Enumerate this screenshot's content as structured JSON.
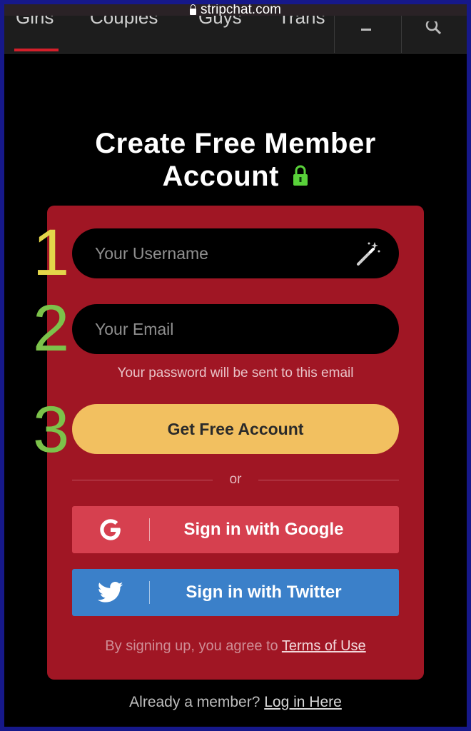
{
  "browser": {
    "url": "stripchat.com"
  },
  "nav": {
    "tabs": [
      {
        "label": "Girls"
      },
      {
        "label": "Couples"
      },
      {
        "label": "Guys"
      },
      {
        "label": "Trans"
      }
    ],
    "icons": [
      "menu-icon",
      "search-icon"
    ]
  },
  "title": {
    "line1": "Create Free Member",
    "line2": "Account"
  },
  "steps": [
    "1",
    "2",
    "3"
  ],
  "form": {
    "username_placeholder": "Your Username",
    "email_placeholder": "Your Email",
    "hint": "Your password will be sent to this email",
    "submit_label": "Get Free Account",
    "or_label": "or",
    "google_label": "Sign in with Google",
    "twitter_label": "Sign in with Twitter",
    "terms_prefix": "By signing up, you agree to ",
    "terms_link": "Terms of Use"
  },
  "footer": {
    "prefix": "Already a member? ",
    "link": "Log in Here"
  },
  "colors": {
    "card": "#a01624",
    "submit": "#f2c060",
    "google": "#d6404f",
    "twitter": "#3b80c9",
    "step1": "#e4d64a",
    "step2": "#7cc24a",
    "step3": "#7cc24a",
    "lock": "#59d13a"
  }
}
